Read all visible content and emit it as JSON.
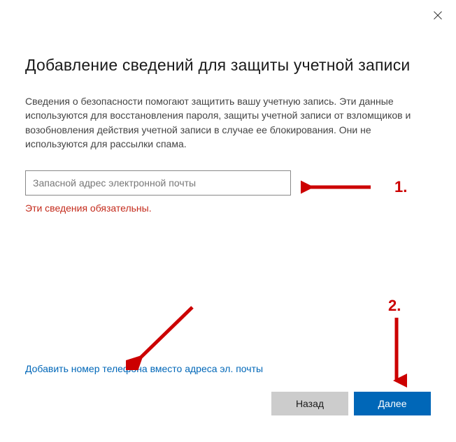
{
  "title": "Добавление сведений для защиты учетной записи",
  "description": "Сведения о безопасности помогают защитить вашу учетную запись. Эти данные используются для восстановления пароля, защиты учетной записи от взломщиков и возобновления действия учетной записи в случае ее блокирования. Они не используются для рассылки спама.",
  "input": {
    "placeholder": "Запасной адрес электронной почты",
    "value": ""
  },
  "error": "Эти сведения обязательны.",
  "link": "Добавить номер телефона вместо адреса эл. почты",
  "buttons": {
    "back": "Назад",
    "next": "Далее"
  },
  "annotations": {
    "label1": "1.",
    "label2": "2."
  }
}
